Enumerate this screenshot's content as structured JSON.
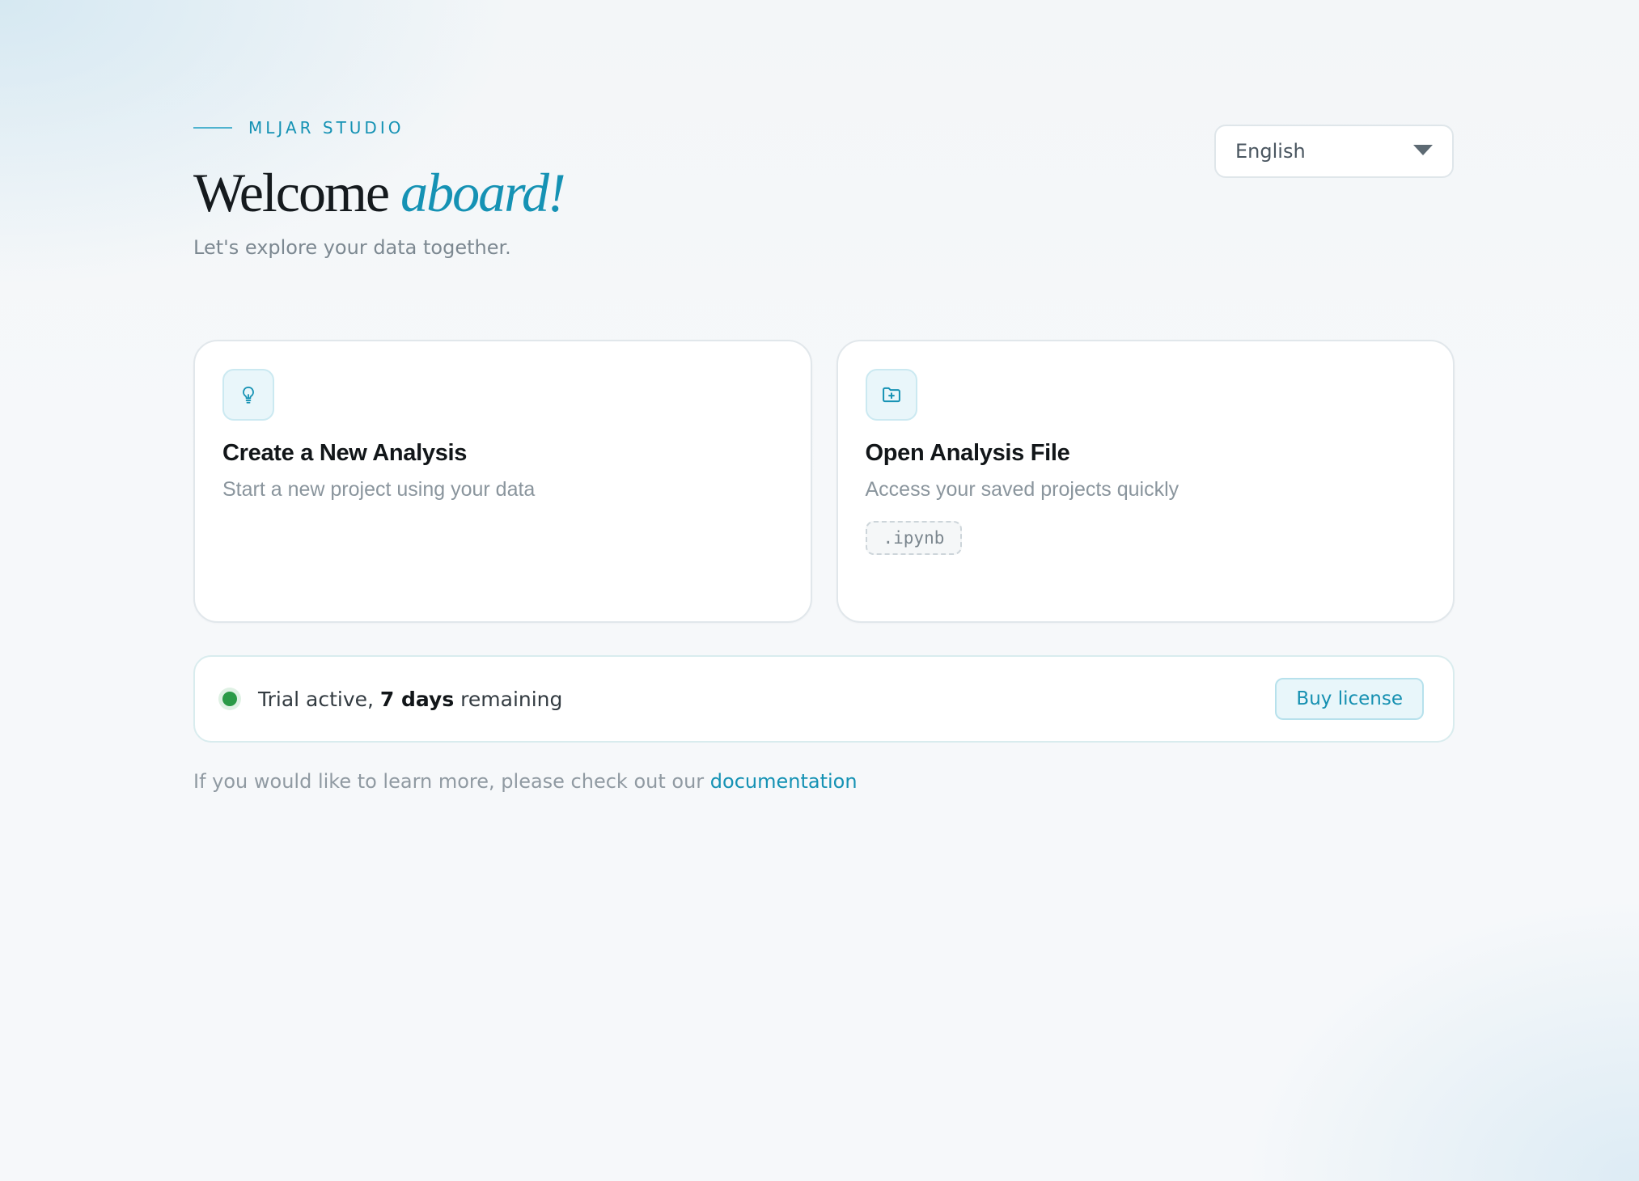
{
  "header": {
    "eyebrow": "MLJAR STUDIO",
    "title_plain": "Welcome",
    "title_accent": "aboard!",
    "subtitle": "Let's explore your data together."
  },
  "language_select": {
    "selected": "English",
    "icon": "chevron-down-icon"
  },
  "cards": [
    {
      "title": "Create a New Analysis",
      "description": "Start a new project using your data",
      "icon": "lightbulb-icon"
    },
    {
      "title": "Open Analysis File",
      "description": "Access your saved projects quickly",
      "icon": "folder-plus-icon",
      "tag": ".ipynb"
    }
  ],
  "trial": {
    "prefix": "Trial active,",
    "days": "7 days",
    "suffix": "remaining",
    "button_label": "Buy license",
    "status_color": "#2a9a47"
  },
  "footer": {
    "text": "If you would like to learn more, please check out our",
    "link_label": "documentation"
  },
  "colors": {
    "accent": "#1592b4",
    "background": "#f6f8fa"
  }
}
